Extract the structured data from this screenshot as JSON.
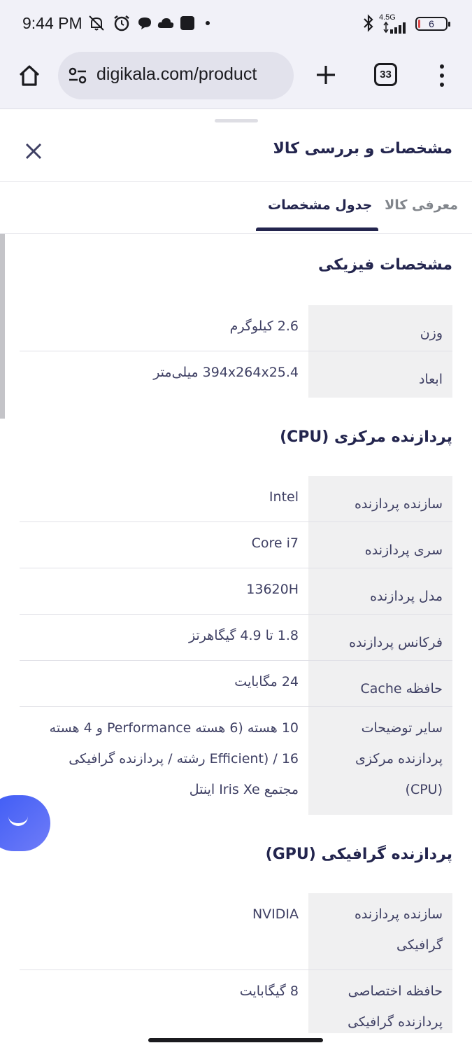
{
  "status_bar": {
    "time": "9:44 PM",
    "network": "4.5G",
    "battery": "6",
    "battery_level_percent": 6
  },
  "browser": {
    "url": "digikala.com/product",
    "tab_count": "33"
  },
  "sheet": {
    "title": "مشخصات و بررسی کالا",
    "tabs": {
      "specs": "جدول مشخصات",
      "intro": "معرفی کالا"
    }
  },
  "sections": {
    "physical": {
      "title": "مشخصات فیزیکی",
      "rows": [
        {
          "key": "وزن",
          "value": "2.6 کیلوگرم"
        },
        {
          "key": "ابعاد",
          "value": "394x264x25.4 میلی‌متر"
        }
      ]
    },
    "cpu": {
      "title": "پردازنده مرکزی (CPU)",
      "rows": [
        {
          "key": "سازنده پردازنده",
          "value": "Intel"
        },
        {
          "key": "سری پردازنده",
          "value": "Core i7"
        },
        {
          "key": "مدل پردازنده",
          "value": "13620H"
        },
        {
          "key": "فرکانس پردازنده",
          "value": "1.8 تا 4.9 گیگاهرتز"
        },
        {
          "key": "حافظه Cache",
          "value": "24 مگابایت"
        },
        {
          "key_lines": [
            "سایر توضیحات",
            "پردازنده مرکزی",
            "(CPU)"
          ],
          "value_lines": [
            "10 هسته (6 هسته Performance و 4 هسته",
            "Efficient) / 16 رشته / پردازنده گرافیکی",
            "مجتمع Iris Xe اینتل"
          ]
        }
      ]
    },
    "gpu": {
      "title": "پردازنده گرافیکی (GPU)",
      "rows": [
        {
          "key_lines": [
            "سازنده پردازنده",
            "گرافیکی"
          ],
          "value": "NVIDIA"
        },
        {
          "key_lines": [
            "حافظه اختصاصی",
            "پردازنده گرافیکی"
          ],
          "value": "8 گیگابایت"
        }
      ]
    }
  },
  "icons": {
    "home": "home-icon",
    "site_settings": "site-settings-icon",
    "new_tab": "plus-icon",
    "menu": "more-vert-icon",
    "close": "close-icon",
    "chat": "chat-smile-icon"
  },
  "colors": {
    "primary_text": "#23254e",
    "muted_text": "#81858b",
    "key_background": "#f0f0f1",
    "fab_blue": "#3d5bf5",
    "battery_red": "#e04b4b"
  }
}
